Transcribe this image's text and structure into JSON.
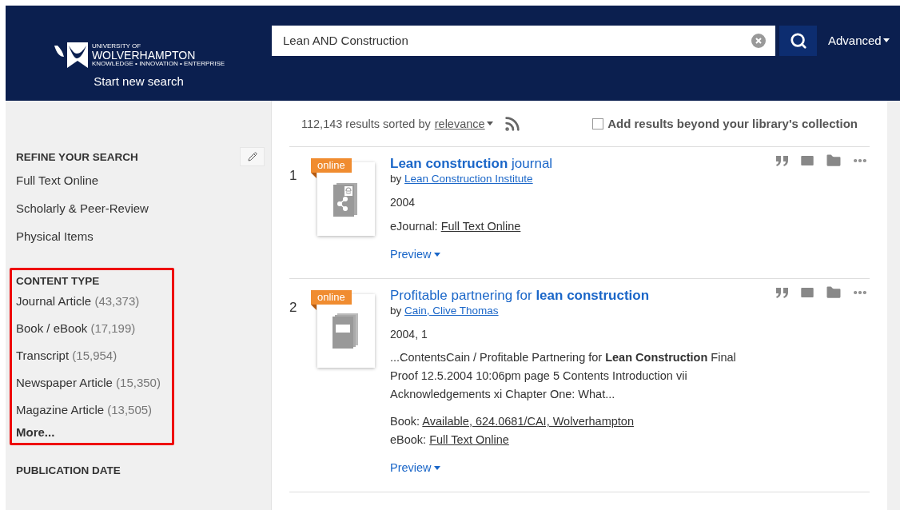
{
  "header": {
    "logo": {
      "line1": "UNIVERSITY OF",
      "line2": "WOLVERHAMPTON",
      "tagline": "KNOWLEDGE • INNOVATION • ENTERPRISE"
    },
    "start_new_search": "Start new search",
    "search": {
      "value": "Lean AND Construction"
    },
    "advanced": "Advanced"
  },
  "sidebar": {
    "refine": {
      "title": "REFINE YOUR SEARCH",
      "items": [
        "Full Text Online",
        "Scholarly & Peer-Review",
        "Physical Items"
      ]
    },
    "content_type": {
      "title": "CONTENT TYPE",
      "highlighted": true,
      "items": [
        {
          "label": "Journal Article",
          "count": "(43,373)"
        },
        {
          "label": "Book / eBook",
          "count": "(17,199)"
        },
        {
          "label": "Transcript",
          "count": "(15,954)"
        },
        {
          "label": "Newspaper Article",
          "count": "(15,350)"
        },
        {
          "label": "Magazine Article",
          "count": "(13,505)"
        }
      ],
      "more": "More..."
    },
    "publication_date": {
      "title": "PUBLICATION DATE"
    }
  },
  "results": {
    "summary": "112,143 results sorted by",
    "sort": "relevance",
    "beyond": {
      "label": "Add results beyond your library's collection",
      "checked": false
    },
    "items": [
      {
        "number": "1",
        "badge": "online",
        "kind": "journal",
        "title": "**Lean construction** journal",
        "by": "by",
        "author": "Lean Construction Institute",
        "year": "2004",
        "access": [
          {
            "label": "eJournal:",
            "link": "Full Text Online"
          }
        ],
        "preview": "Preview"
      },
      {
        "number": "2",
        "badge": "online",
        "kind": "book",
        "title": "Profitable partnering for **lean construction**",
        "by": "by",
        "author": "Cain, Clive Thomas",
        "year": "2004, 1",
        "snippet": "...ContentsCain / Profitable Partnering for **Lean Construction** Final Proof 12.5.2004 10:06pm page 5 Contents Introduction vii Acknowledgements xi Chapter One: What...",
        "access": [
          {
            "label": "Book:",
            "link": "Available, 624.0681/CAI, Wolverhampton"
          },
          {
            "label": "eBook:",
            "link": "Full Text Online"
          }
        ],
        "preview": "Preview"
      }
    ]
  }
}
